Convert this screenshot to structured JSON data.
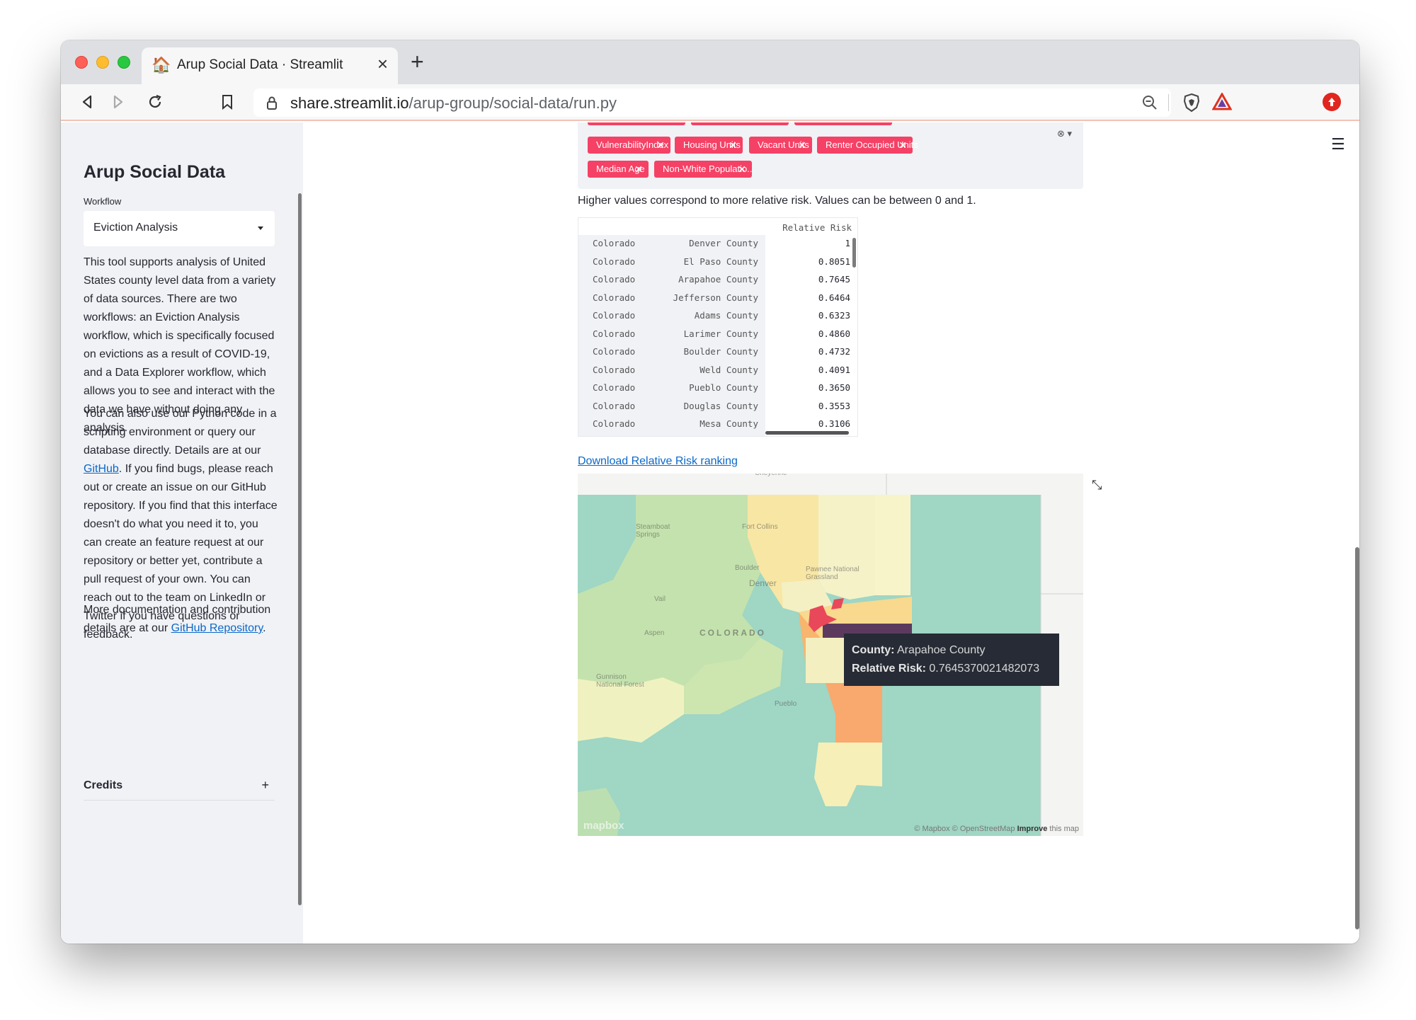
{
  "browser": {
    "tab_title": "Arup Social Data · Streamlit",
    "tab_favicon": "🏠",
    "url_host": "share.streamlit.io",
    "url_path": "/arup-group/social-data/run.py"
  },
  "sidebar": {
    "title": "Arup Social Data",
    "workflow_label": "Workflow",
    "workflow_value": "Eviction Analysis",
    "para1": "This tool supports analysis of United States county level data from a variety of data sources. There are two workflows: an Eviction Analysis workflow, which is specifically focused on evictions as a result of COVID-19, and a Data Explorer workflow, which allows you to see and interact with the data we have without doing any analysis.",
    "para2_pre": "You can also use our Python code in a scripting environment or query our database directly. Details are at our ",
    "para2_link": "GitHub",
    "para2_post": ". If you find bugs, please reach out or create an issue on our GitHub repository. If you find that this interface doesn't do what you need it to, you can create an feature request at our repository or better yet, contribute a pull request of your own. You can reach out to the team on LinkedIn or Twitter if you have questions or feedback.",
    "para3_pre": "More documentation and contribution details are at our ",
    "para3_link": "GitHub Repository",
    "para3_post": ".",
    "credits_label": "Credits",
    "credits_toggle": "+"
  },
  "chips": [
    {
      "label": "VulnerabilityIndex"
    },
    {
      "label": "Housing Units"
    },
    {
      "label": "Vacant Units"
    },
    {
      "label": "Renter Occupied Units"
    },
    {
      "label": "Median Age"
    },
    {
      "label": "Non-White Populatio..."
    }
  ],
  "caption": "Higher values correspond to more relative risk. Values can be between 0 and 1.",
  "table": {
    "header": "Relative Risk",
    "rows": [
      {
        "state": "Colorado",
        "county": "Denver County",
        "risk": "1"
      },
      {
        "state": "Colorado",
        "county": "El Paso County",
        "risk": "0.8051"
      },
      {
        "state": "Colorado",
        "county": "Arapahoe County",
        "risk": "0.7645"
      },
      {
        "state": "Colorado",
        "county": "Jefferson County",
        "risk": "0.6464"
      },
      {
        "state": "Colorado",
        "county": "Adams County",
        "risk": "0.6323"
      },
      {
        "state": "Colorado",
        "county": "Larimer County",
        "risk": "0.4860"
      },
      {
        "state": "Colorado",
        "county": "Boulder County",
        "risk": "0.4732"
      },
      {
        "state": "Colorado",
        "county": "Weld County",
        "risk": "0.4091"
      },
      {
        "state": "Colorado",
        "county": "Pueblo County",
        "risk": "0.3650"
      },
      {
        "state": "Colorado",
        "county": "Douglas County",
        "risk": "0.3553"
      },
      {
        "state": "Colorado",
        "county": "Mesa County",
        "risk": "0.3106"
      }
    ]
  },
  "download_link": "Download Relative Risk ranking",
  "map": {
    "tooltip_county_label": "County:",
    "tooltip_county": "Arapahoe County",
    "tooltip_risk_label": "Relative Risk:",
    "tooltip_risk": "0.7645370021482073",
    "attribution": "© Mapbox © OpenStreetMap ",
    "attribution_improve": "Improve",
    "attribution_post": " this map",
    "logo": "mapbox",
    "labels": [
      "Steamboat Springs",
      "Fort Collins",
      "Boulder",
      "Denver",
      "Vail",
      "Aspen",
      "COLORADO",
      "Gunnison National Forest",
      "Pueblo",
      "Pawnee National Grassland",
      "Cheyenne"
    ],
    "colors": {
      "teal": "#9fd6c4",
      "lightgreen": "#c4e2ad",
      "paleyellow": "#f1f1be",
      "yellow": "#f8e6a4",
      "orange": "#f9a86e",
      "red": "#e8485a",
      "purple": "#5b3a5e"
    }
  },
  "colors": {
    "chip": "#f54165",
    "link": "#0b68c9",
    "sidebar_bg": "#f0f2f6",
    "streamlit_red": "#ff4b4b"
  }
}
